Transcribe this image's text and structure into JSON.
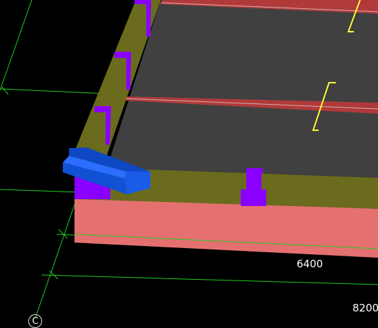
{
  "viewport": {
    "background": "#000000",
    "colors": {
      "gridline": "#1fd11f",
      "slab_top": "#404040",
      "beam_olive": "#6b6b1e",
      "foundation_salmon": "#e47070",
      "column_purple": "#8a00ff",
      "selected_member": "#1152d4",
      "rebar_marker": "#ffff33",
      "rib_red": "#b03a3a"
    }
  },
  "dimensions": {
    "span_1": "6400",
    "span_2": "8200"
  },
  "axis": {
    "label": "C"
  }
}
